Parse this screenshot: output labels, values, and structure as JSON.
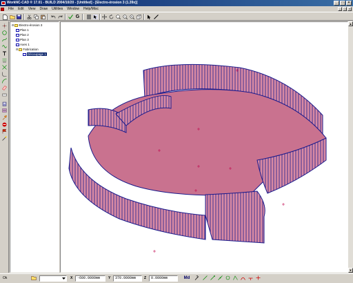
{
  "window": {
    "title": "WorkNC-CAD ® 17.01 - BUILD 2004/10/20 - [Untitled] - [Electro-érosion 3 (1.39x)]",
    "controls": [
      "_",
      "□",
      "×"
    ]
  },
  "menu": {
    "items": [
      "File",
      "Edit",
      "View",
      "Draw",
      "Utilities",
      "Window",
      "Help/Misc"
    ]
  },
  "toolbar": {
    "icons": [
      "new-file-icon",
      "open-file-icon",
      "save-icon",
      "print-icon",
      "cut-icon",
      "copy-icon",
      "paste-icon",
      "undo-icon",
      "redo-icon",
      "checkmark-icon",
      "g-icon",
      "color-swatch-icon",
      "select-icon",
      "pan-icon",
      "rotate-icon",
      "zoom-in-icon",
      "zoom-window-icon",
      "zoom-all-icon",
      "box-view-icon",
      "select-arrow-icon",
      "line-icon"
    ],
    "g_label": "G"
  },
  "tree": {
    "items": [
      {
        "label": "Electro-érosion 3",
        "level": 0,
        "kind": "folder"
      },
      {
        "label": "Plan 1",
        "level": 1,
        "kind": "doc"
      },
      {
        "label": "Plan 2",
        "level": 1,
        "kind": "doc"
      },
      {
        "label": "Plan 3",
        "level": 1,
        "kind": "doc"
      },
      {
        "label": "Axes 1",
        "level": 1,
        "kind": "doc"
      },
      {
        "label": "Fabrication",
        "level": 1,
        "kind": "folder"
      },
      {
        "label": "Découpage 1",
        "level": 2,
        "kind": "doc",
        "selected": true
      }
    ]
  },
  "statusbar": {
    "ok_label": "Ok",
    "x_label": "X",
    "x_value": "-600.0000mm",
    "y_label": "Y",
    "y_value": "370.0000mm",
    "z_label": "Z",
    "z_value": "0.0000mm",
    "mode_label": "Md"
  },
  "colors": {
    "surface_fill": "#c9728f",
    "surface_edge": "#1a1a8c",
    "wall_fill": "#d98aa3",
    "marker": "#c0004a"
  }
}
